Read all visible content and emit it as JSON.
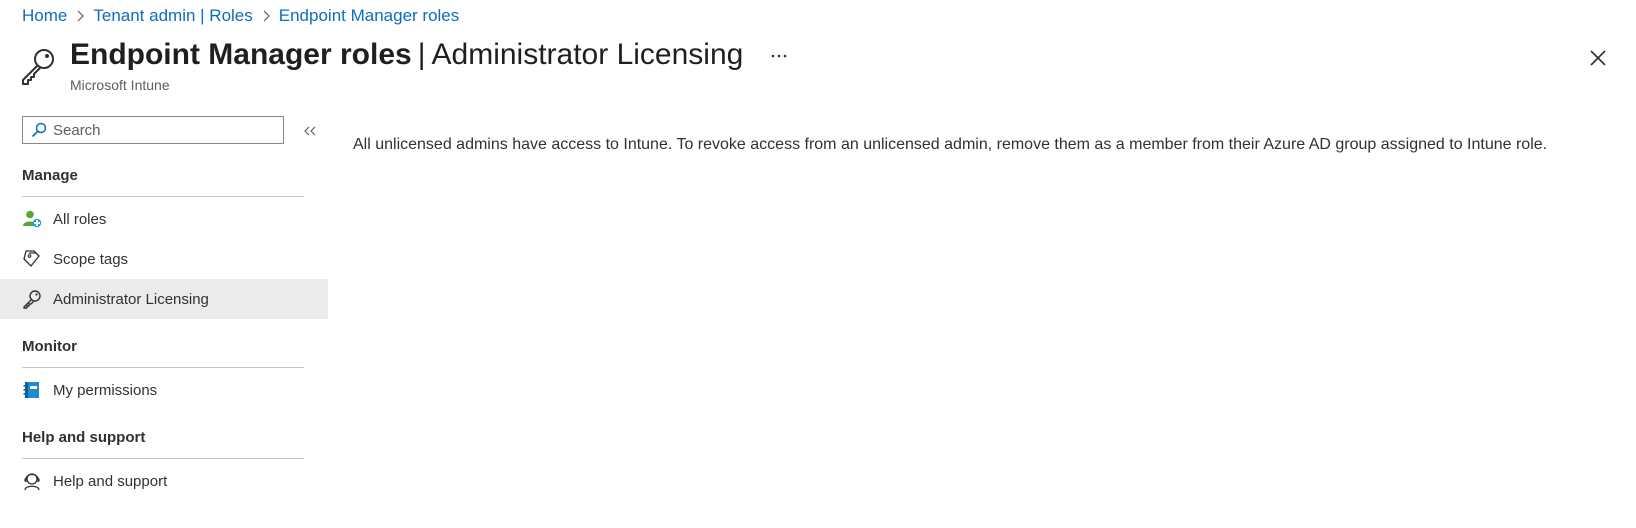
{
  "breadcrumb": {
    "items": [
      "Home",
      "Tenant admin | Roles",
      "Endpoint Manager roles"
    ]
  },
  "header": {
    "title_bold": "Endpoint Manager roles",
    "title_separator": "|",
    "title_rest": "Administrator Licensing",
    "subtitle": "Microsoft Intune",
    "more_label": "...",
    "icons": {
      "header": "key-icon",
      "close": "close-icon"
    }
  },
  "sidebar": {
    "search_placeholder": "Search",
    "sections": {
      "manage": "Manage",
      "monitor": "Monitor",
      "help": "Help and support"
    },
    "items": {
      "all_roles": "All roles",
      "scope_tags": "Scope tags",
      "admin_licensing": "Administrator Licensing",
      "my_permissions": "My permissions",
      "help_support": "Help and support"
    },
    "selected": "admin_licensing"
  },
  "main": {
    "message": "All unlicensed admins have access to Intune. To revoke access from an unlicensed admin, remove them as a member from their Azure AD group assigned to Intune role."
  },
  "colors": {
    "link": "#0f6cbd",
    "selected_bg": "#edebe9",
    "text": "#323130",
    "divider": "#c8c6c4"
  }
}
